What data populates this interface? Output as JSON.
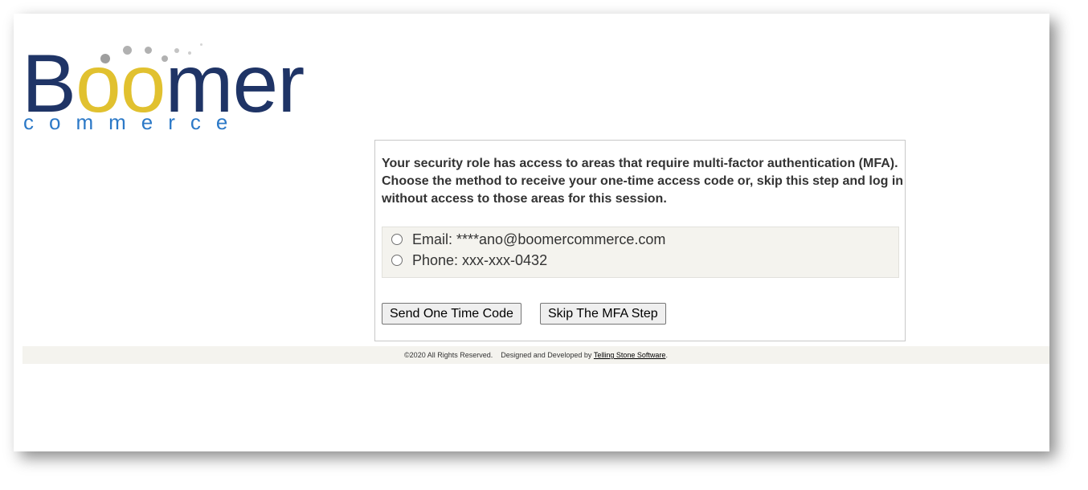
{
  "logo": {
    "word_prefix": "B",
    "word_oo": "oo",
    "word_suffix": "mer",
    "subword": "commerce"
  },
  "mfa": {
    "message": "Your security role has access to areas that require multi-factor authentication (MFA). Choose the method to receive your one-time access code or, skip this step and log in without access to those areas for this session.",
    "options": [
      {
        "label": "Email: ****ano@boomercommerce.com",
        "selected": false
      },
      {
        "label": "Phone: xxx-xxx-0432",
        "selected": false
      }
    ],
    "send_button": "Send One Time Code",
    "skip_button": "Skip The MFA Step"
  },
  "footer": {
    "copyright": "©2020 All Rights Reserved.",
    "designed_prefix": "Designed and Developed by",
    "developer_link": "Telling Stone Software",
    "suffix": "."
  },
  "colors": {
    "logo_navy": "#1f3466",
    "logo_gold": "#e1c12f",
    "logo_blue": "#2c79c7",
    "panel_bg": "#f4f3ee"
  }
}
